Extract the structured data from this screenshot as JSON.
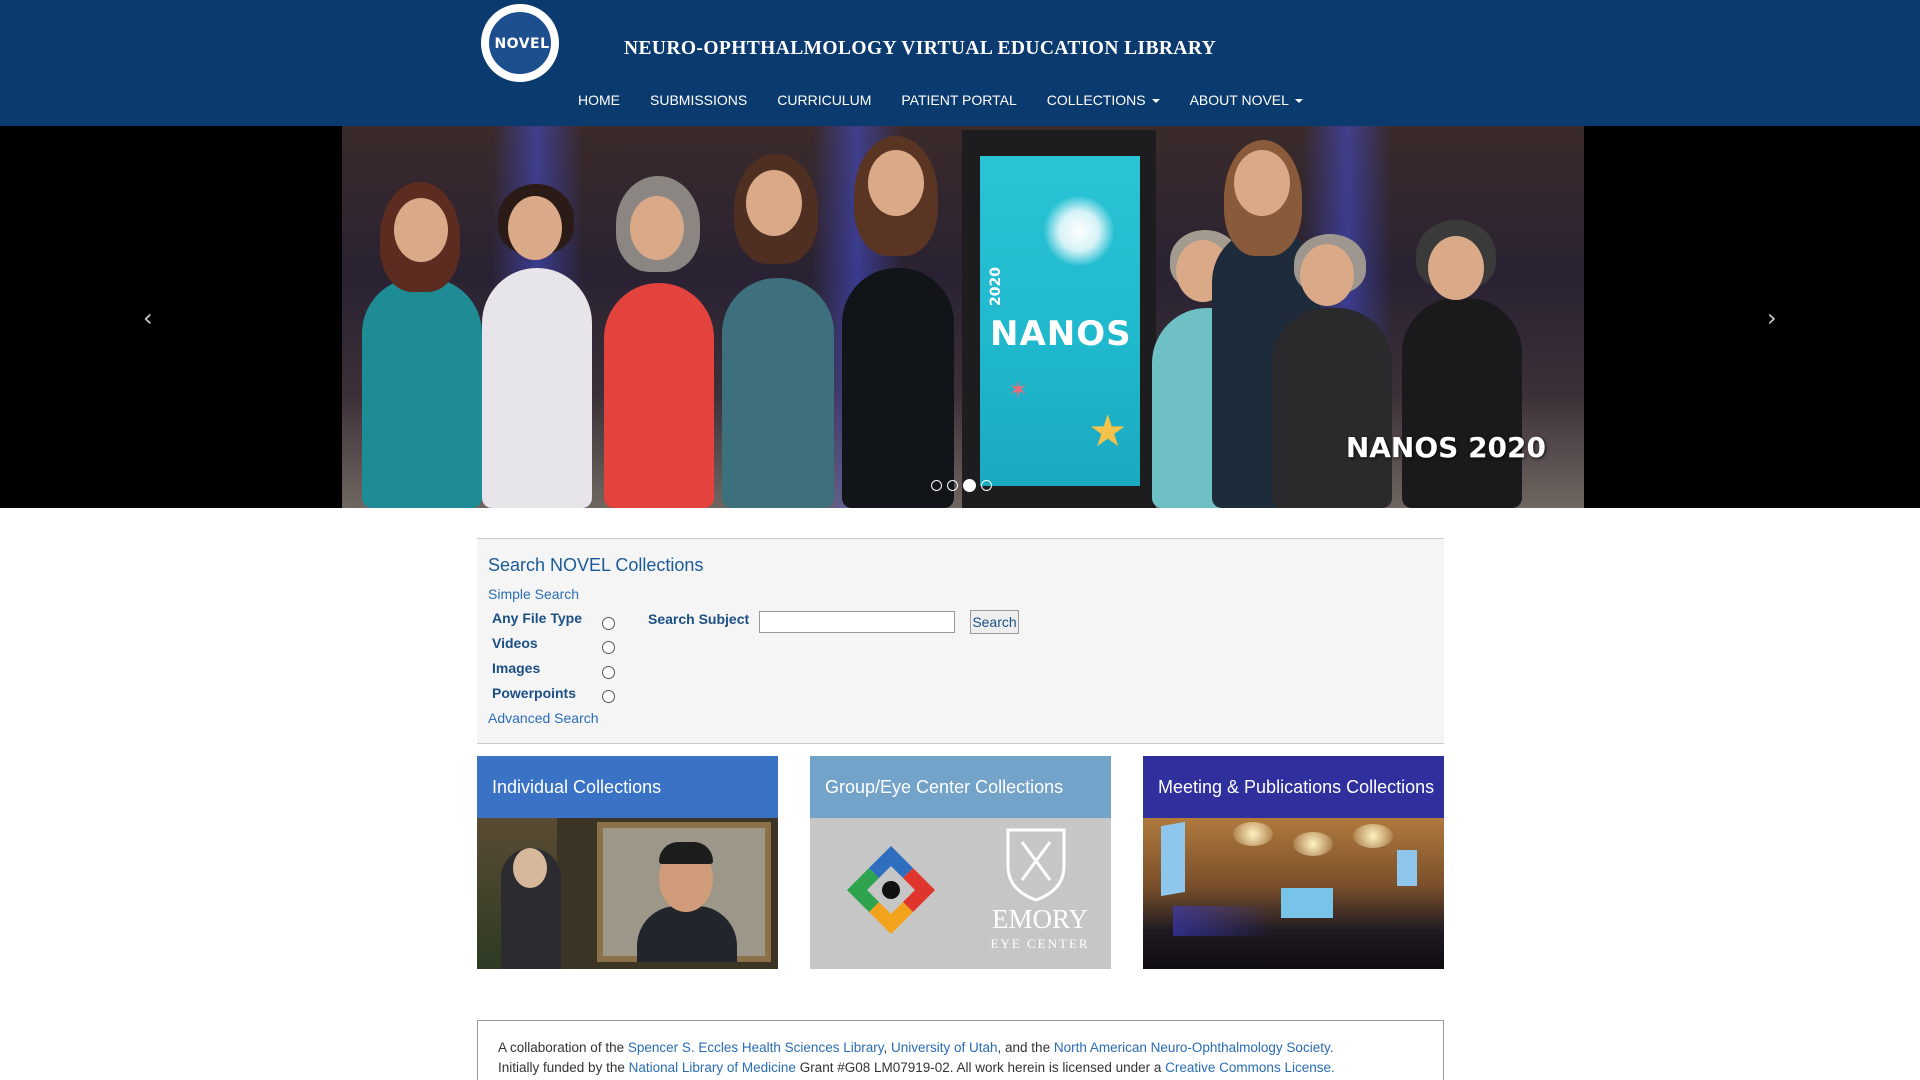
{
  "header": {
    "logo_text": "NOVEL",
    "title": "NEURO-OPHTHALMOLOGY VIRTUAL EDUCATION LIBRARY",
    "nav": [
      {
        "label": "HOME",
        "dropdown": false
      },
      {
        "label": "SUBMISSIONS",
        "dropdown": false
      },
      {
        "label": "CURRICULUM",
        "dropdown": false
      },
      {
        "label": "PATIENT PORTAL",
        "dropdown": false
      },
      {
        "label": "COLLECTIONS",
        "dropdown": true
      },
      {
        "label": "ABOUT NOVEL",
        "dropdown": true
      }
    ]
  },
  "carousel": {
    "caption": "NANOS 2020",
    "banner_text": "NANOS",
    "banner_year": "2020",
    "prev_icon": "‹",
    "next_icon": "›",
    "slide_count": 4,
    "active_slide": 3
  },
  "search": {
    "title": "Search NOVEL Collections",
    "simple_link": "Simple Search",
    "file_types": [
      "Any File Type",
      "Videos",
      "Images",
      "Powerpoints"
    ],
    "subject_label": "Search Subject",
    "subject_value": "",
    "button_label": "Search",
    "advanced_link": "Advanced Search"
  },
  "collections": [
    {
      "title": "Individual Collections",
      "color": "#3a73c6"
    },
    {
      "title": "Group/Eye Center Collections",
      "color": "#73a3c9"
    },
    {
      "title": "Meeting & Publications Collections",
      "color": "#2f2f9e"
    }
  ],
  "emory": {
    "name": "EMORY",
    "sub": "EYE CENTER"
  },
  "footer": {
    "l1_a": "A collaboration of the ",
    "l1_link1": "Spencer S. Eccles Health Sciences Library",
    "l1_sep1": ", ",
    "l1_link2": "University of Utah",
    "l1_b": ", and the ",
    "l1_link3": "North American Neuro-Ophthalmology Society",
    "l1_end": ".",
    "l2_a": "Initially funded by the ",
    "l2_link1": "National Library of Medicine",
    "l2_b": " Grant #G08 LM07919-02. All work herein is licensed under a ",
    "l2_link2": "Creative Commons License",
    "l2_end": "."
  },
  "colors": {
    "header_bg": "#0b3a6e",
    "link": "#2a6db5",
    "label": "#1b4f85"
  }
}
